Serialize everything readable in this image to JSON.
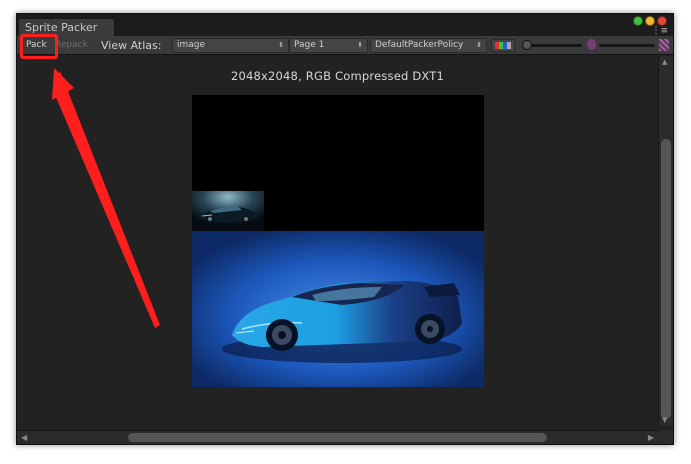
{
  "window": {
    "tab_title": "Sprite Packer",
    "traffic_lights": [
      "#3fbf3f",
      "#f2b632",
      "#e3463a"
    ],
    "menu_icon": "hamburger-menu-icon"
  },
  "toolbar": {
    "pack_label": "Pack",
    "repack_label": "Repack",
    "view_atlas_label": "View Atlas:",
    "atlas_select": "image",
    "page_select": "Page 1",
    "policy_select": "DefaultPackerPolicy",
    "color_icon": "rgb-channels-icon",
    "alpha_icon": "alpha-icon",
    "checker_icon": "checkerboard-icon"
  },
  "canvas": {
    "info_text": "2048x2048, RGB Compressed DXT1",
    "background": "#222222",
    "atlas_background": "#000000"
  },
  "annotation": {
    "color": "#ff1e1e"
  }
}
